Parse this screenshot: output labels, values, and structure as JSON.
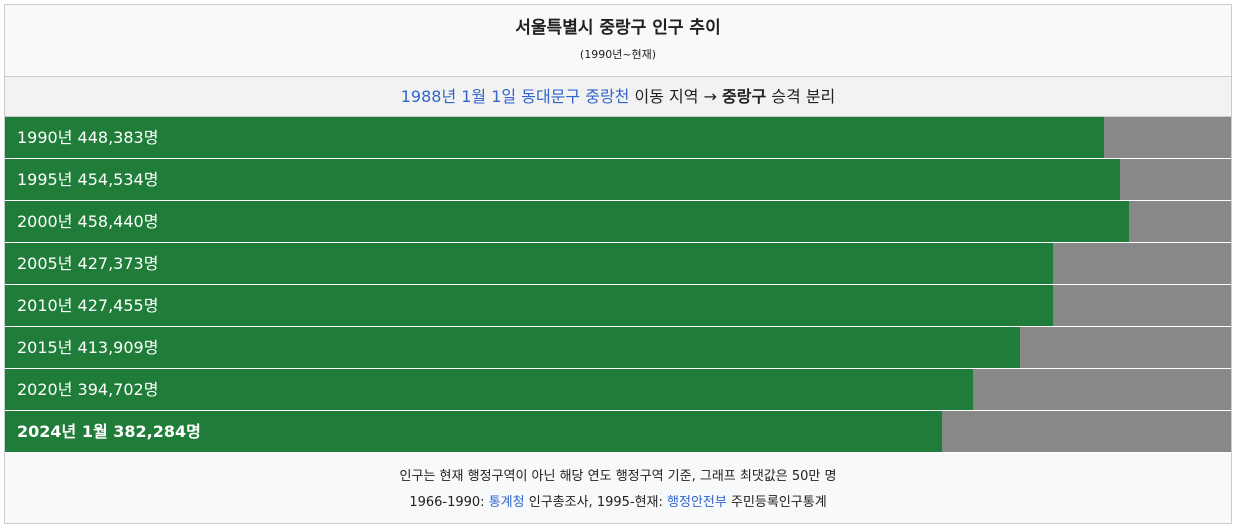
{
  "title": "서울특별시 중랑구 인구 추이",
  "subtitle": "(1990년~현재)",
  "note": {
    "link1": "1988년 1월 1일",
    "link2": "동대문구",
    "link3": "중랑천",
    "text1": "이동 지역",
    "arrow": "→",
    "bold": "중랑구",
    "text2": "승격 분리"
  },
  "footer": {
    "line1": "인구는 현재 행정구역이 아닌 해당 연도 행정구역 기준, 그래프 최댓값은 50만 명",
    "line2_prefix": "1966-1990:",
    "line2_link1": "통계청",
    "line2_mid": "인구총조사, 1995-현재:",
    "line2_link2": "행정안전부",
    "line2_suffix": "주민등록인구통계"
  },
  "colors": {
    "bar": "#1f7d39",
    "remainder": "#888888",
    "link": "#3366cc"
  },
  "chart_data": {
    "type": "bar",
    "orientation": "horizontal",
    "xlim": [
      0,
      500000
    ],
    "categories": [
      "1990년",
      "1995년",
      "2000년",
      "2005년",
      "2010년",
      "2015년",
      "2020년",
      "2024년 1월"
    ],
    "values": [
      448383,
      454534,
      458440,
      427373,
      427455,
      413909,
      394702,
      382284
    ],
    "labels": [
      "1990년 448,383명",
      "1995년 454,534명",
      "2000년 458,440명",
      "2005년 427,373명",
      "2010년 427,455명",
      "2015년 413,909명",
      "2020년 394,702명",
      "2024년 1월 382,284명"
    ],
    "bold_last": true
  }
}
